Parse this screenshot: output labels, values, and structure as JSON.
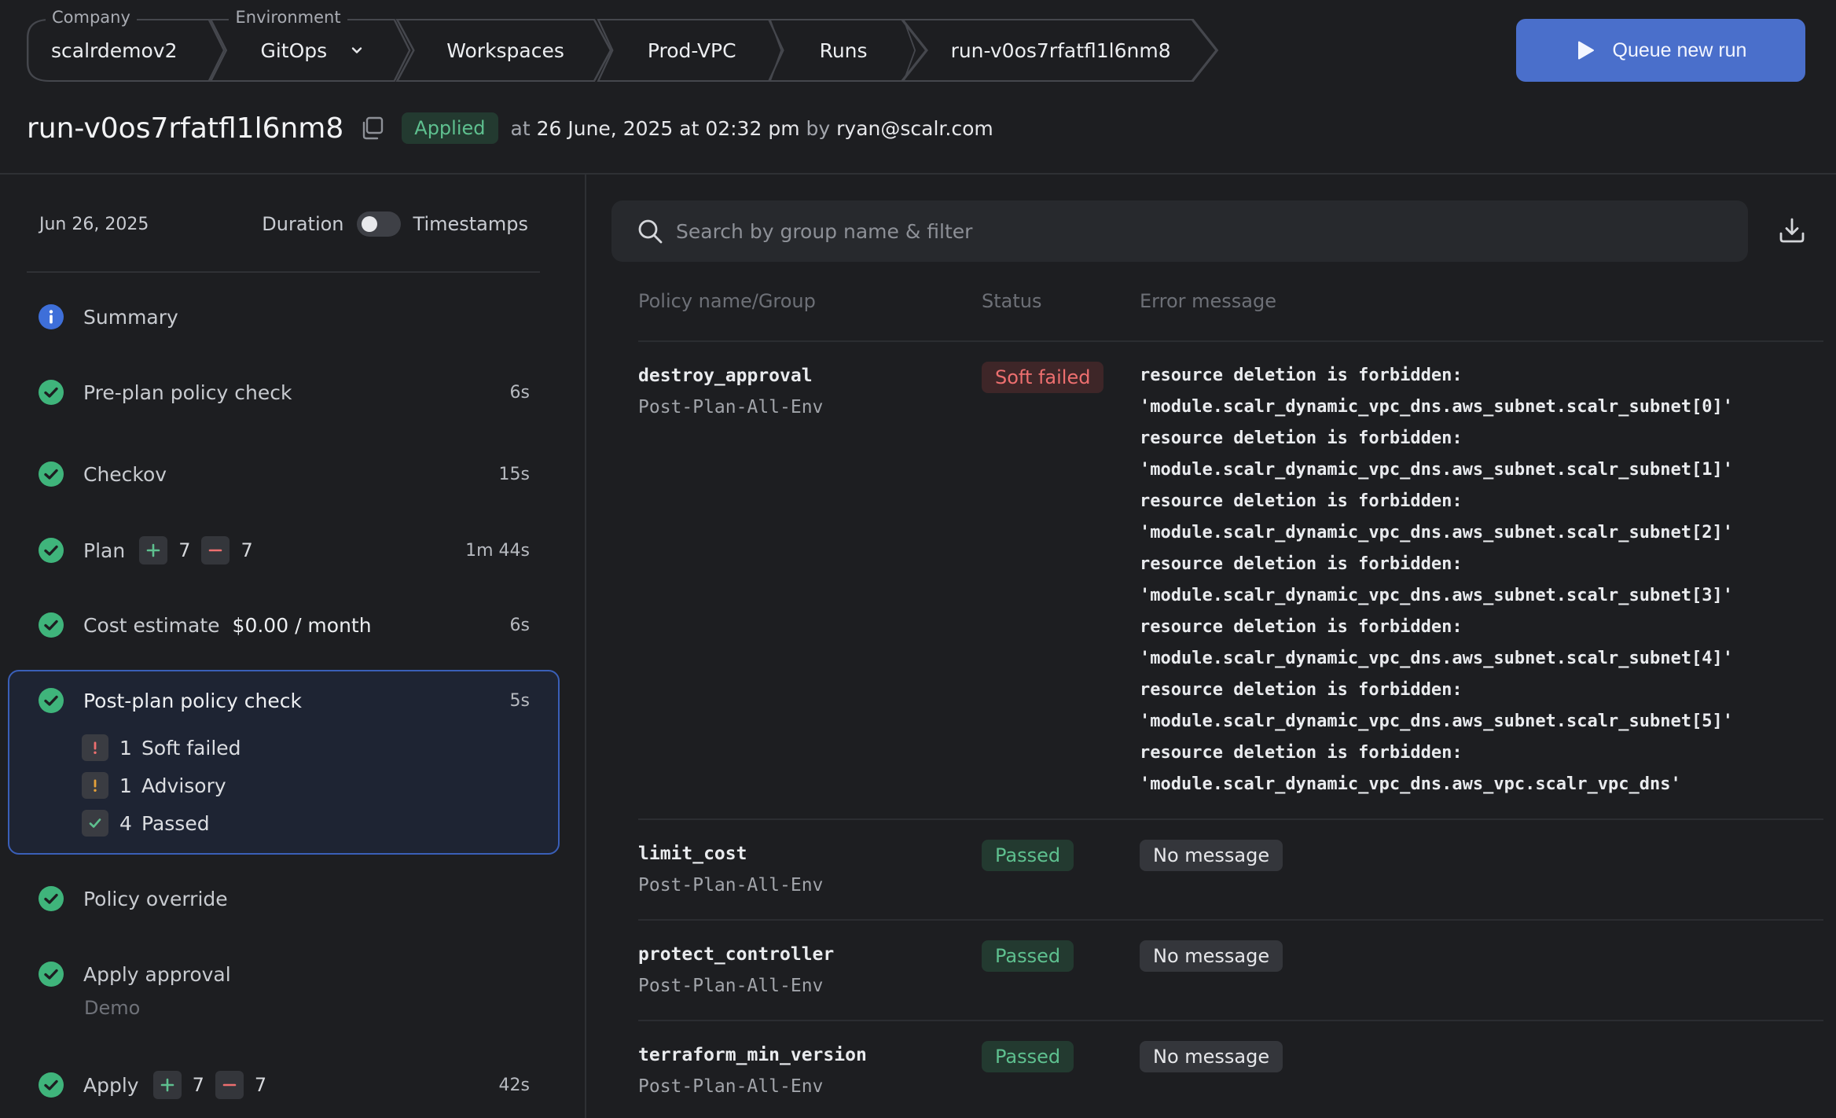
{
  "breadcrumb": [
    {
      "label": "Company",
      "value": "scalrdemov2"
    },
    {
      "label": "Environment",
      "value": "GitOps",
      "dropdown": true
    },
    {
      "label": "",
      "value": "Workspaces"
    },
    {
      "label": "",
      "value": "Prod-VPC"
    },
    {
      "label": "",
      "value": "Runs"
    },
    {
      "label": "",
      "value": "run-v0os7rfatfl1l6nm8"
    }
  ],
  "queue_button": {
    "label": "Queue new run",
    "icon": "play-icon"
  },
  "run": {
    "id": "run-v0os7rfatfl1l6nm8",
    "status": "Applied",
    "at_label": "at",
    "timestamp": "26 June, 2025 at 02:32 pm",
    "by_label": "by",
    "user": "ryan@scalr.com"
  },
  "timeline": {
    "date": "Jun 26, 2025",
    "toggle_left": "Duration",
    "toggle_right": "Timestamps",
    "steps": [
      {
        "name": "Summary",
        "icon": "info-icon"
      },
      {
        "name": "Pre-plan policy check",
        "duration": "6s",
        "icon": "check-circle-icon"
      },
      {
        "name": "Checkov",
        "duration": "15s",
        "icon": "check-circle-icon"
      },
      {
        "name": "Plan",
        "duration": "1m 44s",
        "icon": "check-circle-icon",
        "add": "7",
        "destroy": "7"
      },
      {
        "name": "Cost estimate",
        "duration": "6s",
        "icon": "check-circle-icon",
        "cost": "$0.00 / month"
      },
      {
        "name": "Post-plan policy check",
        "duration": "5s",
        "icon": "check-circle-icon",
        "active": true
      },
      {
        "name": "Policy override",
        "icon": "check-circle-icon"
      },
      {
        "name": "Apply approval",
        "icon": "check-circle-icon",
        "note": "Demo"
      },
      {
        "name": "Apply",
        "duration": "42s",
        "icon": "check-circle-icon",
        "add": "7",
        "destroy": "7"
      }
    ],
    "policy_summary": [
      {
        "count": "1",
        "label": "Soft failed",
        "icon": "exclamation-icon",
        "color": "#ed6f6f"
      },
      {
        "count": "1",
        "label": "Advisory",
        "icon": "exclamation-icon",
        "color": "#e5a13a"
      },
      {
        "count": "4",
        "label": "Passed",
        "icon": "check-icon",
        "color": "#5ec08f"
      }
    ]
  },
  "search": {
    "placeholder": "Search by group name & filter"
  },
  "table": {
    "headers": [
      "Policy name/Group",
      "Status",
      "Error message"
    ],
    "rows": [
      {
        "name": "destroy_approval",
        "group": "Post-Plan-All-Env",
        "status": "Soft failed",
        "messages": [
          "resource deletion is forbidden:",
          "'module.scalr_dynamic_vpc_dns.aws_subnet.scalr_subnet[0]'",
          "resource deletion is forbidden:",
          "'module.scalr_dynamic_vpc_dns.aws_subnet.scalr_subnet[1]'",
          "resource deletion is forbidden:",
          "'module.scalr_dynamic_vpc_dns.aws_subnet.scalr_subnet[2]'",
          "resource deletion is forbidden:",
          "'module.scalr_dynamic_vpc_dns.aws_subnet.scalr_subnet[3]'",
          "resource deletion is forbidden:",
          "'module.scalr_dynamic_vpc_dns.aws_subnet.scalr_subnet[4]'",
          "resource deletion is forbidden:",
          "'module.scalr_dynamic_vpc_dns.aws_subnet.scalr_subnet[5]'",
          "resource deletion is forbidden:",
          "'module.scalr_dynamic_vpc_dns.aws_vpc.scalr_vpc_dns'"
        ]
      },
      {
        "name": "limit_cost",
        "group": "Post-Plan-All-Env",
        "status": "Passed",
        "message": "No message"
      },
      {
        "name": "protect_controller",
        "group": "Post-Plan-All-Env",
        "status": "Passed",
        "message": "No message"
      },
      {
        "name": "terraform_min_version",
        "group": "Post-Plan-All-Env",
        "status": "Passed",
        "message": "No message"
      }
    ]
  },
  "colors": {
    "accent": "#4a6fcb",
    "success": "#5ec08f",
    "danger": "#ed6f6f",
    "warning": "#e5a13a",
    "background": "#1d1e21"
  }
}
